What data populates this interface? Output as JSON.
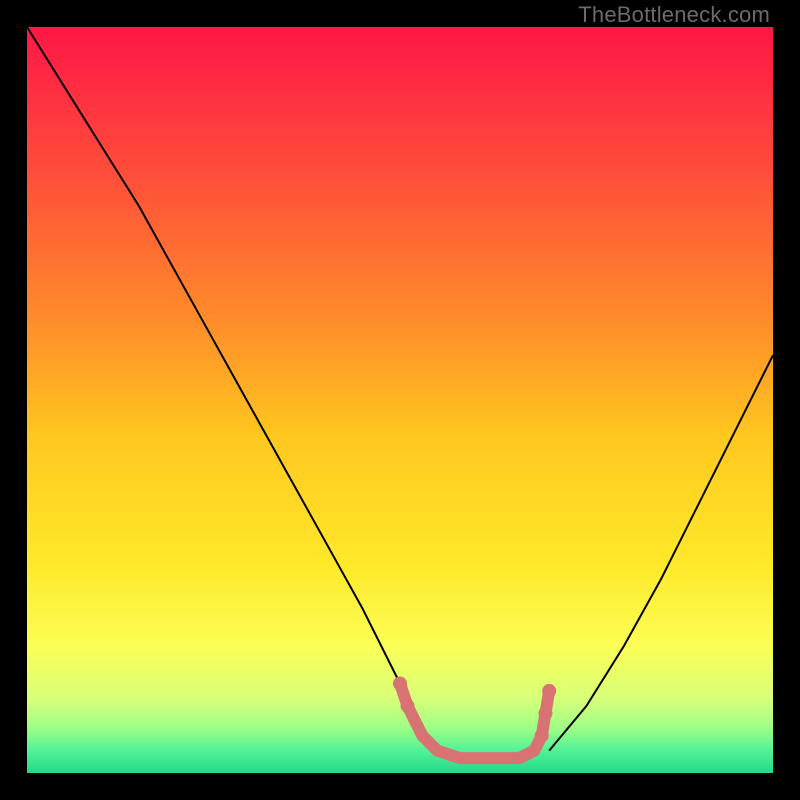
{
  "watermark": "TheBottleneck.com",
  "chart_data": {
    "type": "line",
    "title": "",
    "xlabel": "",
    "ylabel": "",
    "xlim": [
      0,
      100
    ],
    "ylim": [
      0,
      100
    ],
    "grid": false,
    "legend": false,
    "background_gradient": {
      "stops": [
        {
          "pos": 0.0,
          "color": "#ff1747"
        },
        {
          "pos": 0.2,
          "color": "#ff4f3a"
        },
        {
          "pos": 0.4,
          "color": "#ff8f2a"
        },
        {
          "pos": 0.55,
          "color": "#ffc81f"
        },
        {
          "pos": 0.72,
          "color": "#ffe92a"
        },
        {
          "pos": 0.83,
          "color": "#fbff55"
        },
        {
          "pos": 0.9,
          "color": "#d8ff7a"
        },
        {
          "pos": 0.94,
          "color": "#9dff86"
        },
        {
          "pos": 0.97,
          "color": "#52f297"
        },
        {
          "pos": 1.0,
          "color": "#22d98b"
        }
      ]
    },
    "series": [
      {
        "name": "bottleneck-curve-left",
        "color": "#000000",
        "width": 2,
        "x": [
          0,
          5,
          10,
          15,
          20,
          25,
          30,
          35,
          40,
          45,
          50,
          53,
          55
        ],
        "y": [
          100,
          92,
          84,
          76,
          67,
          58,
          49,
          40,
          31,
          22,
          12,
          6,
          3
        ]
      },
      {
        "name": "bottleneck-curve-right",
        "color": "#000000",
        "width": 2,
        "x": [
          70,
          75,
          80,
          85,
          90,
          95,
          100
        ],
        "y": [
          3,
          9,
          17,
          26,
          36,
          46,
          56
        ]
      },
      {
        "name": "valley-marker",
        "color": "#d97272",
        "width": 12,
        "linecap": "round",
        "x": [
          50,
          51,
          52,
          53,
          55,
          58,
          62,
          66,
          68,
          69,
          69.5,
          70
        ],
        "y": [
          12,
          9,
          7,
          5,
          3,
          2,
          2,
          2,
          3,
          5,
          8,
          11
        ]
      }
    ]
  }
}
